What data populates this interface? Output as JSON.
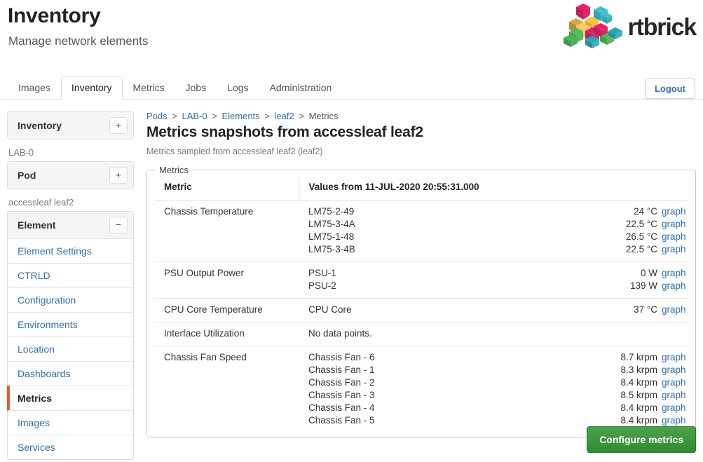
{
  "header": {
    "title": "Inventory",
    "subtitle": "Manage network elements",
    "brand_word": "rtbrick",
    "brand_mark_icon": "rtbrick-isometric-blocks-logo"
  },
  "topnav": {
    "tabs": [
      {
        "label": "Images",
        "active": false
      },
      {
        "label": "Inventory",
        "active": true
      },
      {
        "label": "Metrics",
        "active": false
      },
      {
        "label": "Jobs",
        "active": false
      },
      {
        "label": "Logs",
        "active": false
      },
      {
        "label": "Administration",
        "active": false
      }
    ],
    "logout_label": "Logout"
  },
  "sidebar": {
    "panels": [
      {
        "title": "Inventory",
        "toggle": "+",
        "toggle_icon": "plus-icon"
      },
      {
        "title": "Pod",
        "toggle": "+",
        "toggle_icon": "plus-icon"
      },
      {
        "title": "Element",
        "toggle": "−",
        "toggle_icon": "minus-icon"
      }
    ],
    "group_labels": [
      "LAB-0",
      "accessleaf leaf2"
    ],
    "element_items": [
      {
        "label": "Element Settings",
        "active": false
      },
      {
        "label": "CTRLD",
        "active": false
      },
      {
        "label": "Configuration",
        "active": false
      },
      {
        "label": "Environments",
        "active": false
      },
      {
        "label": "Location",
        "active": false
      },
      {
        "label": "Dashboards",
        "active": false
      },
      {
        "label": "Metrics",
        "active": true
      },
      {
        "label": "Images",
        "active": false
      },
      {
        "label": "Services",
        "active": false
      }
    ],
    "active_accent_color": "#e3602a"
  },
  "main": {
    "breadcrumb": [
      {
        "label": "Pods",
        "link": true
      },
      {
        "label": "LAB-0",
        "link": true
      },
      {
        "label": "Elements",
        "link": true
      },
      {
        "label": "leaf2",
        "link": true
      },
      {
        "label": "Metrics",
        "link": false
      }
    ],
    "breadcrumb_separator": ">",
    "page_title": "Metrics snapshots from accessleaf leaf2",
    "page_description": "Metrics sampled from accessleaf leaf2 (leaf2)",
    "fieldset_legend": "Metrics",
    "table": {
      "columns": [
        "Metric",
        "Values from 11-JUL-2020 20:55:31.000"
      ],
      "graph_link_label": "graph",
      "no_data_label": "No data points.",
      "rows": [
        {
          "metric": "Chassis Temperature",
          "samples": [
            {
              "label": "LM75-2-49",
              "value": "24 °C"
            },
            {
              "label": "LM75-3-4A",
              "value": "22.5 °C"
            },
            {
              "label": "LM75-1-48",
              "value": "26.5 °C"
            },
            {
              "label": "LM75-3-4B",
              "value": "22.5 °C"
            }
          ]
        },
        {
          "metric": "PSU Output Power",
          "samples": [
            {
              "label": "PSU-1",
              "value": "0 W"
            },
            {
              "label": "PSU-2",
              "value": "139 W"
            }
          ]
        },
        {
          "metric": "CPU Core Temperature",
          "samples": [
            {
              "label": "CPU Core",
              "value": "37 °C"
            }
          ]
        },
        {
          "metric": "Interface Utilization",
          "samples": [],
          "empty_text": "No data points."
        },
        {
          "metric": "Chassis Fan Speed",
          "samples": [
            {
              "label": "Chassis Fan - 6",
              "value": "8.7 krpm"
            },
            {
              "label": "Chassis Fan - 1",
              "value": "8.3 krpm"
            },
            {
              "label": "Chassis Fan - 2",
              "value": "8.4 krpm"
            },
            {
              "label": "Chassis Fan - 3",
              "value": "8.5 krpm"
            },
            {
              "label": "Chassis Fan - 4",
              "value": "8.4 krpm"
            },
            {
              "label": "Chassis Fan - 5",
              "value": "8.4 krpm"
            }
          ]
        }
      ]
    },
    "configure_button_label": "Configure metrics"
  },
  "colors": {
    "link": "#2f6fb5",
    "accent_orange": "#e3602a",
    "success_green": "#3c8f3c",
    "text": "#333333",
    "muted": "#777777"
  }
}
